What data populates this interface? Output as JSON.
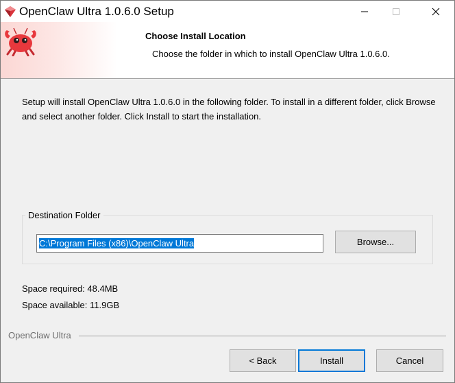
{
  "window": {
    "title": "OpenClaw Ultra 1.0.6.0 Setup",
    "controls": {
      "minimize": "minimize",
      "maximize": "maximize",
      "close": "close"
    }
  },
  "header": {
    "title": "Choose Install Location",
    "subtitle": "Choose the folder in which to install OpenClaw Ultra 1.0.6.0.",
    "logo_icon": "red-crab-mascot-icon"
  },
  "body": {
    "intro": "Setup will install OpenClaw Ultra 1.0.6.0 in the following folder. To install in a different folder, click Browse and select another folder. Click Install to start the installation.",
    "destination": {
      "legend": "Destination Folder",
      "path": "C:\\Program Files (x86)\\OpenClaw Ultra",
      "browse_label": "Browse..."
    },
    "space_required": "Space required: 48.4MB",
    "space_available": "Space available: 11.9GB"
  },
  "footer": {
    "brand": "OpenClaw Ultra",
    "back_label": "< Back",
    "install_label": "Install",
    "cancel_label": "Cancel"
  },
  "colors": {
    "accent": "#0078d7",
    "mascot": "#e8383d",
    "header_gradient": "#fbd7d4"
  }
}
